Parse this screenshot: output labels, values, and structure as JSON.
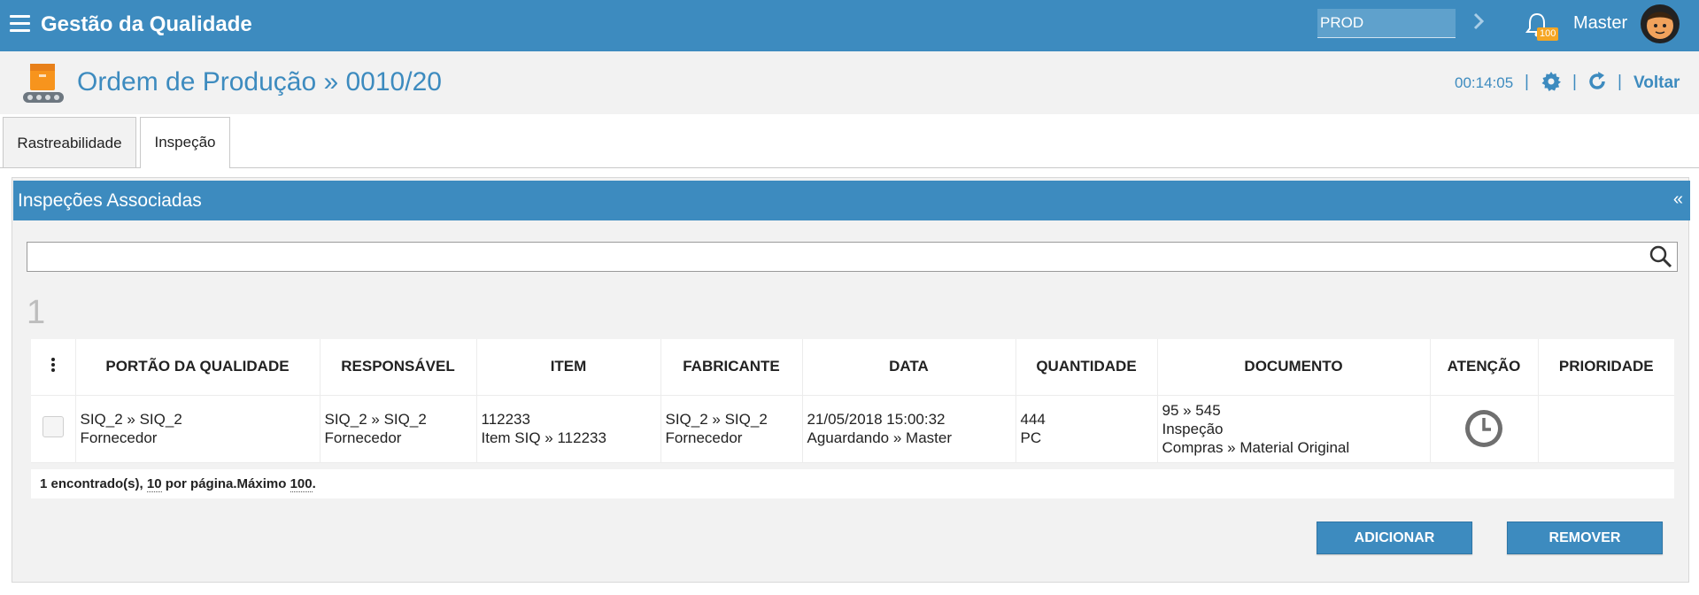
{
  "app": {
    "title": "Gestão da Qualidade"
  },
  "topbar": {
    "env_value": "PROD",
    "notifications_count": "100",
    "user_name": "Master"
  },
  "page": {
    "title": "Ordem de Produção » 0010/20",
    "timer": "00:14:05",
    "separator": "|",
    "back_label": "Voltar"
  },
  "tabs": [
    {
      "label": "Rastreabilidade",
      "active": false
    },
    {
      "label": "Inspeção",
      "active": true
    }
  ],
  "panel": {
    "title": "Inspeções Associadas",
    "collapse": "«",
    "search_value": "",
    "count": "1"
  },
  "table": {
    "headers": [
      "PORTÃO DA QUALIDADE",
      "RESPONSÁVEL",
      "ITEM",
      "FABRICANTE",
      "DATA",
      "QUANTIDADE",
      "DOCUMENTO",
      "ATENÇÃO",
      "PRIORIDADE"
    ],
    "rows": [
      {
        "portao": [
          "SIQ_2 » SIQ_2",
          "Fornecedor"
        ],
        "responsavel": [
          "SIQ_2 » SIQ_2",
          "Fornecedor"
        ],
        "item": [
          "112233",
          "Item SIQ » 112233"
        ],
        "fabricante": [
          "SIQ_2 » SIQ_2",
          "Fornecedor"
        ],
        "data": [
          "21/05/2018 15:00:32",
          "Aguardando » Master"
        ],
        "quantidade": [
          "444",
          "PC"
        ],
        "documento": [
          "95 » 545",
          "Inspeção",
          "Compras » Material Original"
        ],
        "atencao_icon": "clock-icon",
        "prioridade": ""
      }
    ]
  },
  "footer": {
    "found_text": "1 encontrado(s), ",
    "per_page": "10",
    "per_page_text": " por página.Máximo ",
    "max": "100",
    "end": "."
  },
  "buttons": {
    "add": "ADICIONAR",
    "remove": "REMOVER"
  },
  "colors": {
    "primary": "#3d8bbf",
    "badge": "#f5a623",
    "background": "#f2f2f2"
  }
}
